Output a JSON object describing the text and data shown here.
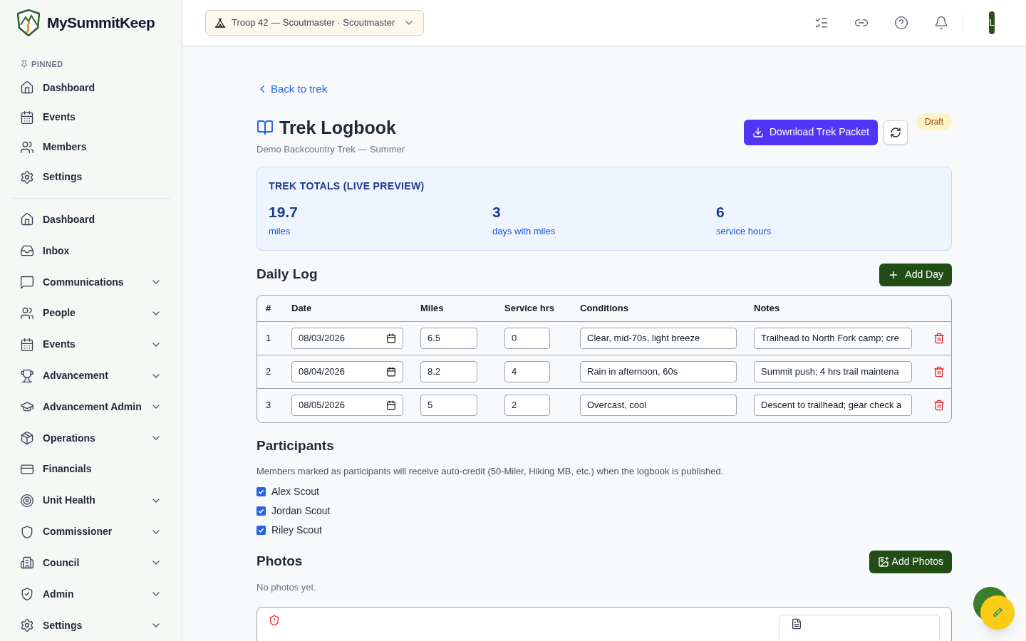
{
  "brand": {
    "name": "MySummitKeep"
  },
  "sidebar": {
    "pinned_label": "PINNED",
    "pinned": [
      {
        "label": "Dashboard"
      },
      {
        "label": "Events"
      },
      {
        "label": "Members"
      },
      {
        "label": "Settings"
      }
    ],
    "items": [
      {
        "label": "Dashboard",
        "expandable": false
      },
      {
        "label": "Inbox",
        "expandable": false
      },
      {
        "label": "Communications",
        "expandable": true
      },
      {
        "label": "People",
        "expandable": true
      },
      {
        "label": "Events",
        "expandable": true
      },
      {
        "label": "Advancement",
        "expandable": true
      },
      {
        "label": "Advancement Admin",
        "expandable": true
      },
      {
        "label": "Operations",
        "expandable": true
      },
      {
        "label": "Financials",
        "expandable": false
      },
      {
        "label": "Unit Health",
        "expandable": true
      },
      {
        "label": "Commissioner",
        "expandable": true
      },
      {
        "label": "Council",
        "expandable": true
      },
      {
        "label": "Admin",
        "expandable": true
      },
      {
        "label": "Settings",
        "expandable": true
      }
    ]
  },
  "topbar": {
    "unit_selector": "Troop 42 — Scoutmaster · Scoutmaster",
    "avatar": "L"
  },
  "page": {
    "back_link": "Back to trek",
    "title": "Trek Logbook",
    "subtitle": "Demo Backcountry Trek — Summer",
    "download_button": "Download Trek Packet",
    "status_badge": "Draft"
  },
  "totals": {
    "title": "TREK TOTALS (LIVE PREVIEW)",
    "stats": [
      {
        "value": "19.7",
        "label": "miles"
      },
      {
        "value": "3",
        "label": "days with miles"
      },
      {
        "value": "6",
        "label": "service hours"
      }
    ]
  },
  "daily_log": {
    "title": "Daily Log",
    "add_button": "Add Day",
    "columns": [
      "#",
      "Date",
      "Miles",
      "Service hrs",
      "Conditions",
      "Notes"
    ],
    "rows": [
      {
        "number": "1",
        "date": "08/03/2026",
        "miles": "6.5",
        "service_hrs": "0",
        "conditions": "Clear, mid-70s, light breeze",
        "notes": "Trailhead to North Fork camp; cre"
      },
      {
        "number": "2",
        "date": "08/04/2026",
        "miles": "8.2",
        "service_hrs": "4",
        "conditions": "Rain in afternoon, 60s",
        "notes": "Summit push; 4 hrs trail maintena"
      },
      {
        "number": "3",
        "date": "08/05/2026",
        "miles": "5",
        "service_hrs": "2",
        "conditions": "Overcast, cool",
        "notes": "Descent to trailhead; gear check a"
      }
    ]
  },
  "participants": {
    "title": "Participants",
    "description": "Members marked as participants will receive auto-credit (50-Miler, Hiking MB, etc.) when the logbook is published.",
    "members": [
      {
        "name": "Alex Scout",
        "checked": true
      },
      {
        "name": "Jordan Scout",
        "checked": true
      },
      {
        "name": "Riley Scout",
        "checked": true
      }
    ]
  },
  "photos": {
    "title": "Photos",
    "add_button": "Add Photos",
    "empty_text": "No photos yet."
  }
}
